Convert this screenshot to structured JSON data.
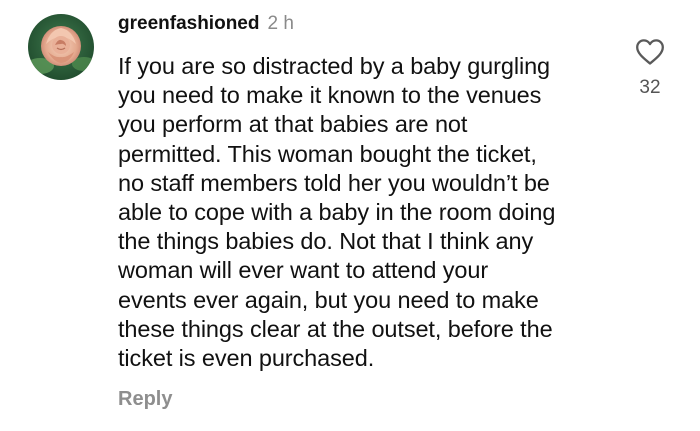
{
  "comment": {
    "username": "greenfashioned",
    "timestamp": "2 h",
    "avatar_icon": "rose-avatar",
    "text_lines": [
      "If you are so distracted by a baby gurgling",
      "you need to make it known to the venues",
      "you perform at that babies are not",
      "permitted.  This woman bought the ticket,",
      "no staff members told her you wouldn’t be",
      "able to cope with a baby in the room doing",
      "the things babies do.  Not that I think any",
      "woman will ever want to attend your",
      "events ever again, but you need to make",
      "these things clear at the outset, before the",
      "ticket is even purchased."
    ],
    "reply_label": "Reply",
    "like_icon": "heart-outline-icon",
    "like_count": "32"
  },
  "colors": {
    "text": "#111111",
    "muted": "#8e8e8e",
    "background": "#ffffff"
  }
}
